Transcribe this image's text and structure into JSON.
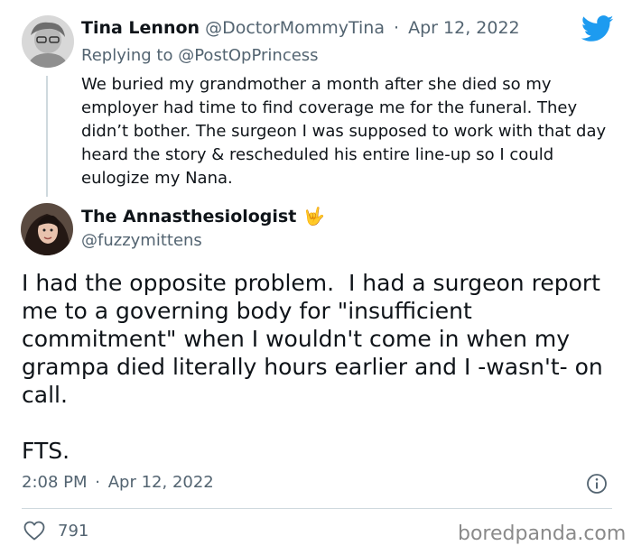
{
  "reply_tweet": {
    "author_name": "Tina Lennon",
    "author_handle": "@DoctorMommyTina",
    "separator": "·",
    "date": "Apr 12, 2022",
    "replying_prefix": "Replying to",
    "replying_to": "@PostOpPrincess",
    "text": "We buried my grandmother a month after she died so my employer had time to find coverage me for the funeral. They didn’t bother. The surgeon I was supposed to work with that day heard the story & rescheduled his entire line-up so I could eulogize my Nana."
  },
  "main_tweet": {
    "author_name": "The Annasthesiologist",
    "author_emoji": "🤟",
    "author_handle": "@fuzzymittens",
    "text": "I had the opposite problem.  I had a surgeon report me to a governing body for \"insufficient commitment\" when I wouldn't come in when my grampa died literally hours earlier and I -wasn't- on call.\n\nFTS.",
    "time": "2:08 PM",
    "separator": "·",
    "date": "Apr 12, 2022",
    "likes": "791"
  },
  "icons": {
    "brand": "twitter-bird-icon",
    "info": "info-icon",
    "like": "heart-icon"
  },
  "colors": {
    "twitter_blue": "#1d9bf0",
    "muted_text": "#536471"
  },
  "watermark": "boredpanda.com"
}
